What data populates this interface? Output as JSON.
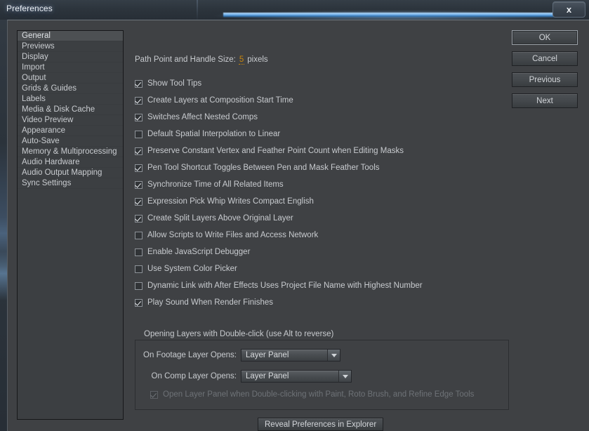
{
  "window": {
    "title": "Preferences",
    "close_icon": "close-x-icon",
    "close_label": "x"
  },
  "sidebar": {
    "items": [
      {
        "label": "General",
        "selected": true
      },
      {
        "label": "Previews",
        "selected": false
      },
      {
        "label": "Display",
        "selected": false
      },
      {
        "label": "Import",
        "selected": false
      },
      {
        "label": "Output",
        "selected": false
      },
      {
        "label": "Grids & Guides",
        "selected": false
      },
      {
        "label": "Labels",
        "selected": false
      },
      {
        "label": "Media & Disk Cache",
        "selected": false
      },
      {
        "label": "Video Preview",
        "selected": false
      },
      {
        "label": "Appearance",
        "selected": false
      },
      {
        "label": "Auto-Save",
        "selected": false
      },
      {
        "label": "Memory & Multiprocessing",
        "selected": false
      },
      {
        "label": "Audio Hardware",
        "selected": false
      },
      {
        "label": "Audio Output Mapping",
        "selected": false
      },
      {
        "label": "Sync Settings",
        "selected": false
      }
    ]
  },
  "general": {
    "path_point": {
      "label": "Path Point and Handle Size:",
      "value": "5",
      "unit": "pixels",
      "accent_color": "#c8860c"
    },
    "checkboxes": [
      {
        "label": "Show Tool Tips",
        "checked": true
      },
      {
        "label": "Create Layers at Composition Start Time",
        "checked": true
      },
      {
        "label": "Switches Affect Nested Comps",
        "checked": true
      },
      {
        "label": "Default Spatial Interpolation to Linear",
        "checked": false
      },
      {
        "label": "Preserve Constant Vertex and Feather Point Count when Editing Masks",
        "checked": true
      },
      {
        "label": "Pen Tool Shortcut Toggles Between Pen and Mask Feather Tools",
        "checked": true
      },
      {
        "label": "Synchronize Time of All Related Items",
        "checked": true
      },
      {
        "label": "Expression Pick Whip Writes Compact English",
        "checked": true
      },
      {
        "label": "Create Split Layers Above Original Layer",
        "checked": true
      },
      {
        "label": "Allow Scripts to Write Files and Access Network",
        "checked": false
      },
      {
        "label": "Enable JavaScript Debugger",
        "checked": false
      },
      {
        "label": "Use System Color Picker",
        "checked": false
      },
      {
        "label": "Dynamic Link with After Effects Uses Project File Name with Highest Number",
        "checked": false
      },
      {
        "label": "Play Sound When Render Finishes",
        "checked": true
      }
    ]
  },
  "group": {
    "title": "Opening Layers with Double-click (use Alt to reverse)",
    "footage_label": "On Footage Layer Opens:",
    "footage_value": "Layer Panel",
    "comp_label": "On Comp Layer Opens:",
    "comp_value": "Layer Panel",
    "open_layer_panel": {
      "label": "Open Layer Panel when Double-clicking with Paint, Roto Brush, and Refine Edge Tools",
      "checked": true,
      "disabled": true
    }
  },
  "buttons": {
    "ok": "OK",
    "cancel": "Cancel",
    "previous": "Previous",
    "next": "Next",
    "reveal": "Reveal Preferences in Explorer"
  }
}
